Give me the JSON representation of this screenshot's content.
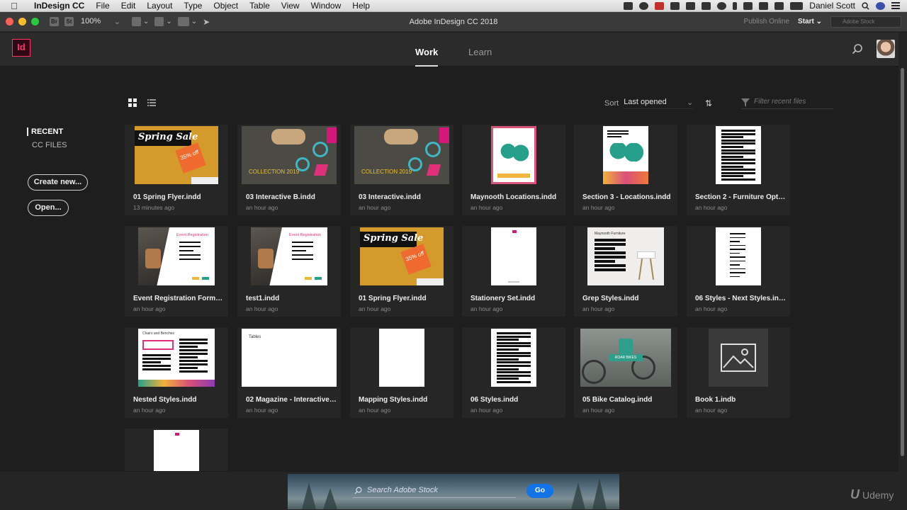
{
  "menubar": {
    "app_name": "InDesign CC",
    "items": [
      "File",
      "Edit",
      "Layout",
      "Type",
      "Object",
      "Table",
      "View",
      "Window",
      "Help"
    ],
    "user": "Daniel Scott"
  },
  "titlebar": {
    "zoom": "100%",
    "title": "Adobe InDesign CC 2018",
    "publish": "Publish Online",
    "workspace": "Start",
    "stock_placeholder": "Adobe Stock",
    "bridge": "Br",
    "stock_btn": "St"
  },
  "nav": {
    "logo": "Id",
    "tabs": [
      "Work",
      "Learn"
    ]
  },
  "sidebar": {
    "recent": "RECENT",
    "cc_files": "CC FILES",
    "create": "Create new...",
    "open": "Open..."
  },
  "toolbar": {
    "sort_label": "Sort",
    "sort_value": "Last opened",
    "filter_placeholder": "Filter recent files"
  },
  "files": [
    {
      "name": "01 Spring Flyer.indd",
      "time": "13 minutes ago",
      "thumb": "spring"
    },
    {
      "name": "03 Interactive B.indd",
      "time": "an hour ago",
      "thumb": "interactive"
    },
    {
      "name": "03 Interactive.indd",
      "time": "an hour ago",
      "thumb": "interactive"
    },
    {
      "name": "Maynooth Locations.indd",
      "time": "an hour ago",
      "thumb": "map1"
    },
    {
      "name": "Section 3 - Locations.indd",
      "time": "an hour ago",
      "thumb": "map2"
    },
    {
      "name": "Section 2 - Furniture Optio…",
      "time": "an hour ago",
      "thumb": "textpage"
    },
    {
      "name": "Event Registration Form.in…",
      "time": "an hour ago",
      "thumb": "event"
    },
    {
      "name": "test1.indd",
      "time": "an hour ago",
      "thumb": "event"
    },
    {
      "name": "01 Spring Flyer.indd",
      "time": "an hour ago",
      "thumb": "spring"
    },
    {
      "name": "Stationery Set.indd",
      "time": "an hour ago",
      "thumb": "stationery"
    },
    {
      "name": "Grep Styles.indd",
      "time": "an hour ago",
      "thumb": "grep"
    },
    {
      "name": "06 Styles - Next Styles.indd",
      "time": "an hour ago",
      "thumb": "lightpage"
    },
    {
      "name": "Nested Styles.indd",
      "time": "an hour ago",
      "thumb": "nested"
    },
    {
      "name": "02 Magazine - Interactive …",
      "time": "an hour ago",
      "thumb": "tables"
    },
    {
      "name": "Mapping Styles.indd",
      "time": "an hour ago",
      "thumb": "blank"
    },
    {
      "name": "06 Styles.indd",
      "time": "an hour ago",
      "thumb": "textpage"
    },
    {
      "name": "05 Bike Catalog.indd",
      "time": "an hour ago",
      "thumb": "bike"
    },
    {
      "name": "Book 1.indb",
      "time": "an hour ago",
      "thumb": "book"
    },
    {
      "name": "",
      "time": "",
      "thumb": "stationery"
    }
  ],
  "thumb_text": {
    "spring_title": "Spring Sale",
    "spring_badge": "35% off",
    "collection": "COLLECTION 2019",
    "event_title": "Event Registration",
    "grep_title": "Maynooth Furniture",
    "nested_title": "Chairs and Benches",
    "tables_title": "Tables",
    "bike_title": "ROAR BIKES"
  },
  "bottom": {
    "search_placeholder": "Search Adobe Stock",
    "go": "Go",
    "brand": "Udemy"
  },
  "colors": {
    "accent_blue": "#1473e6",
    "indesign_pink": "#ff3366",
    "spring_yellow": "#e0a32a"
  }
}
